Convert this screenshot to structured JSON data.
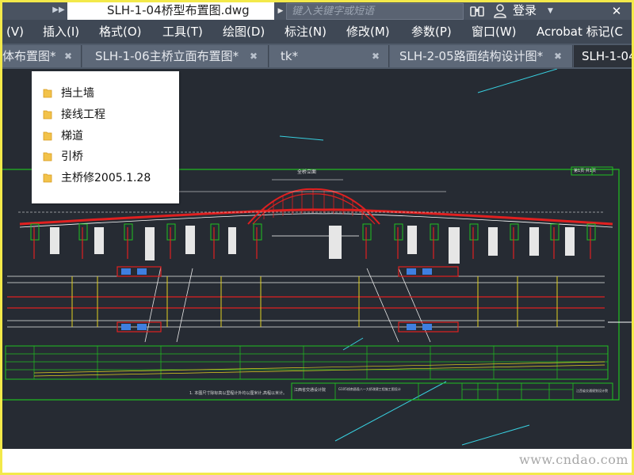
{
  "window": {
    "document_title": "SLH-1-04桥型布置图.dwg",
    "search_placeholder": "键入关键字或短语",
    "login_label": "登录"
  },
  "menu": [
    {
      "label": "(V)"
    },
    {
      "label": "插入(I)"
    },
    {
      "label": "格式(O)"
    },
    {
      "label": "工具(T)"
    },
    {
      "label": "绘图(D)"
    },
    {
      "label": "标注(N)"
    },
    {
      "label": "修改(M)"
    },
    {
      "label": "参数(P)"
    },
    {
      "label": "窗口(W)"
    },
    {
      "label": "Acrobat 标记(C"
    }
  ],
  "tabs": [
    {
      "label": "体布置图*",
      "active": false
    },
    {
      "label": "SLH-1-06主桥立面布置图*",
      "active": false
    },
    {
      "label": "tk*",
      "active": false
    },
    {
      "label": "SLH-2-05路面结构设计图*",
      "active": false
    },
    {
      "label": "SLH-1-04",
      "active": true
    }
  ],
  "folder_list": [
    {
      "label": "挡土墙"
    },
    {
      "label": "接线工程"
    },
    {
      "label": "梯道"
    },
    {
      "label": "引桥"
    },
    {
      "label": "主桥修2005.1.28"
    }
  ],
  "drawing": {
    "title_label": "全桥立面",
    "sheet_label": "第1页 共1页",
    "note": "1. 本图尺寸除标高以里程计外均以厘米计,高程以米计。",
    "footer_left": "江西省交通设计院",
    "footer_mid": "G105线南昌段八一大桥改建工程施工图设计",
    "footer_right": "江西省交通规划设计院"
  },
  "watermark": "www.cndao.com",
  "colors": {
    "canvas_bg": "#262b33",
    "menubar_bg": "#3f4855",
    "frame_green": "#20c020",
    "arch_red": "#e02020"
  }
}
